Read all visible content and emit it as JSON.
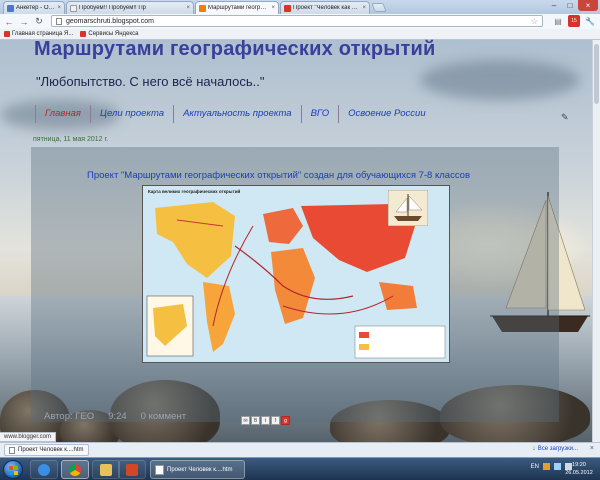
{
  "browser": {
    "tabs": [
      {
        "label": "Анкетер - Опрос",
        "favicon_color": "#4a79c9",
        "active": false
      },
      {
        "label": "Пробуем!! Пробуем!! Пр",
        "favicon_color": "#f0f0f0",
        "active": false
      },
      {
        "label": "Маршрутами географич",
        "favicon_color": "#f57d00",
        "active": true
      },
      {
        "label": "Проект \"Человек как элем",
        "favicon_color": "#d8352a",
        "active": false
      }
    ],
    "url": "geomarschruti.blogspot.com",
    "bookmarks": [
      "Главная страница Я...",
      "Сервисы Яндекса"
    ],
    "status_url": "www.blogger.com",
    "extension_badge": "15"
  },
  "blog": {
    "title": "Маршрутами географических открытий",
    "description": "\"Любопытство. С него всё началось..\"",
    "nav": [
      {
        "label": "Главная",
        "active": true
      },
      {
        "label": "Цели проекта",
        "active": false
      },
      {
        "label": "Актуальность проекта",
        "active": false
      },
      {
        "label": "ВГО",
        "active": false
      },
      {
        "label": "Освоение России",
        "active": false
      }
    ]
  },
  "post": {
    "date": "пятница, 11 мая 2012 г.",
    "title": "Проект \"Маршрутами географических открытий\" создан для обучающихся 7-8  классов",
    "map_heading": "Карта великих географических открытий",
    "author": "Автор: ГЕО",
    "time": "9:24",
    "comments": "0 коммент"
  },
  "downloads": {
    "item": "Проект Человек к....htm",
    "show_all": "Все загрузки..."
  },
  "taskbar": {
    "language": "EN",
    "time": "19:20",
    "date": "26.05.2012"
  },
  "colors": {
    "title": "#3a3f9b",
    "nav_link": "#1a3cbf",
    "nav_active": "#b3262a",
    "date": "#3c6e3c"
  }
}
